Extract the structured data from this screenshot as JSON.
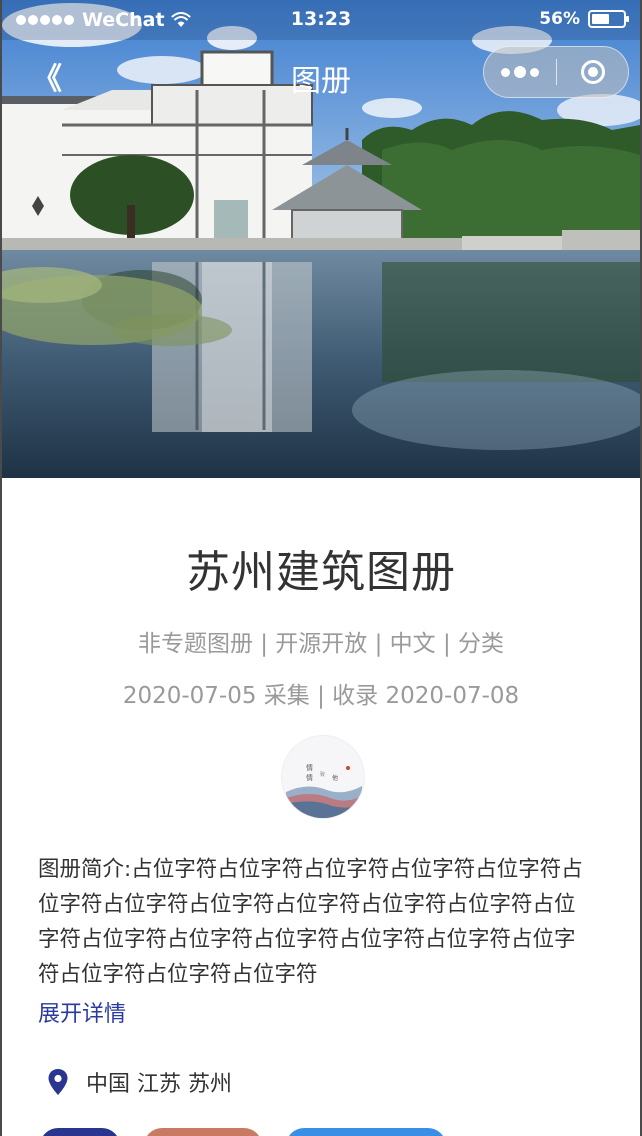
{
  "status_bar": {
    "carrier": "WeChat",
    "time": "13:23",
    "battery_percent": "56%",
    "battery_level": 0.56
  },
  "nav": {
    "back_icon": "《",
    "title": "图册"
  },
  "album": {
    "title": "苏州建筑图册",
    "tags": "非专题图册 | 开源开放 | 中文 | 分类",
    "dates": "2020-07-05 采集 | 收录 2020-07-08",
    "description": "图册简介:占位字符占位字符占位字符占位字符占位字符占位字符占位字符占位字符占位字符占位字符占位字符占位字符占位字符占位字符占位字符占位字符占位字符占位字符占位字符占位字符占位字符",
    "expand_label": "展开详情",
    "location": "中国 江苏 苏州"
  },
  "icons": {
    "back": "back-chevron-icon",
    "more": "more-dots-icon",
    "close": "close-ring-icon",
    "location": "location-pin-icon",
    "wifi": "wifi-icon",
    "battery": "battery-icon"
  },
  "colors": {
    "title": "#333333",
    "meta": "#9a9a9a",
    "link": "#2b3aa0",
    "pin": "#2a3590",
    "button_1": "#2a3590",
    "button_2": "#c97a63",
    "button_3": "#3a8ee6"
  }
}
